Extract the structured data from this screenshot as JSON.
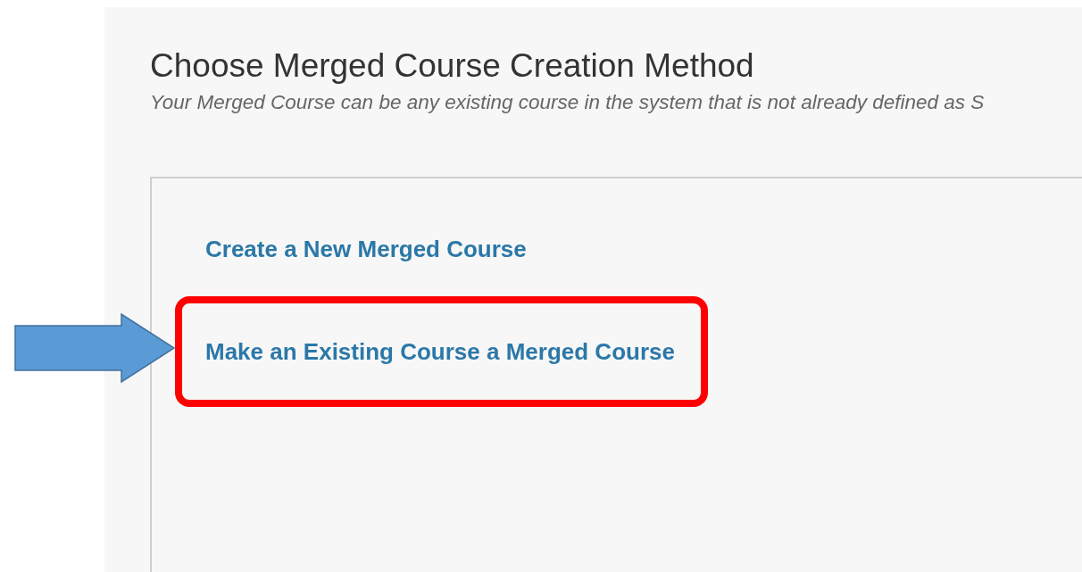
{
  "heading": "Choose Merged Course Creation Method",
  "subtitle": "Your Merged Course can be any existing course in the system that is not already defined as S",
  "links": [
    {
      "label": "Create a New Merged Course",
      "highlighted": false
    },
    {
      "label": "Make an Existing Course a Merged Course",
      "highlighted": true
    }
  ]
}
